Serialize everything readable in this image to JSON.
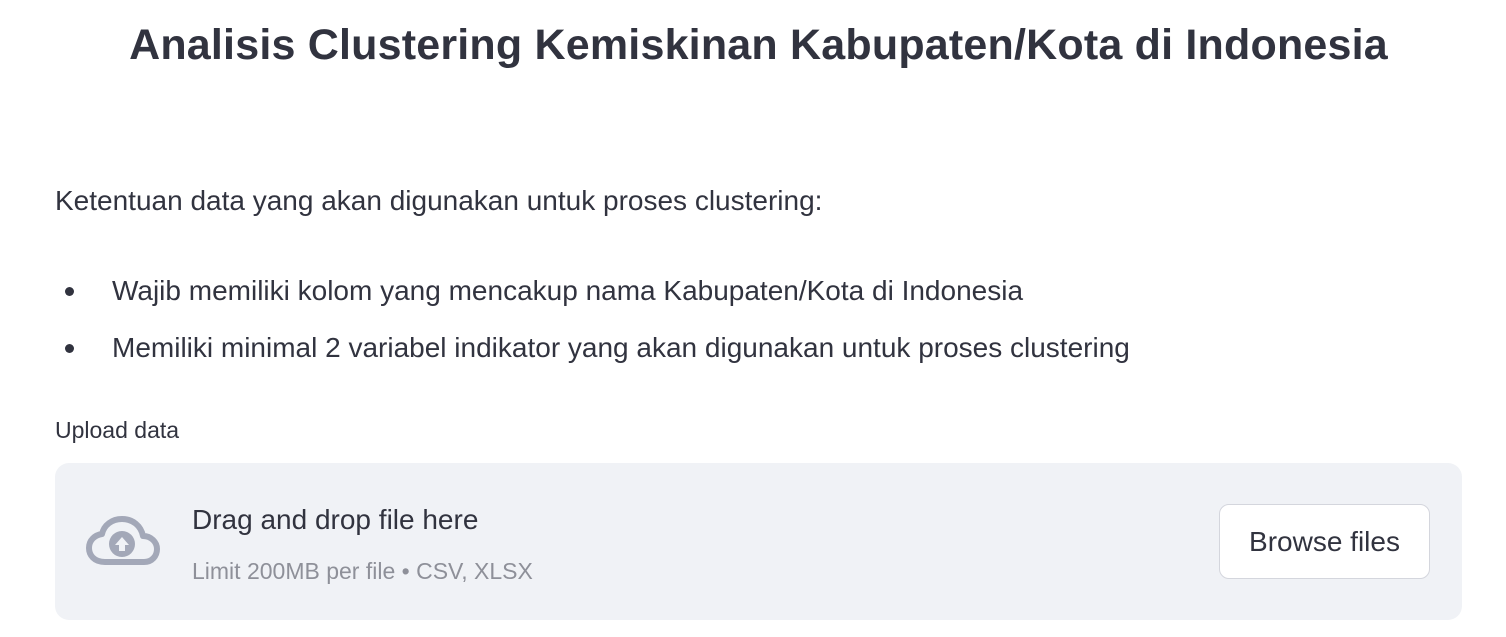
{
  "page": {
    "title": "Analisis Clustering Kemiskinan Kabupaten/Kota di Indonesia"
  },
  "requirements": {
    "intro": "Ketentuan data yang akan digunakan untuk proses clustering:",
    "items": [
      "Wajib memiliki kolom yang mencakup nama Kabupaten/Kota di Indonesia",
      "Memiliki minimal 2 variabel indikator yang akan digunakan untuk proses clustering"
    ]
  },
  "uploader": {
    "label": "Upload data",
    "drop_title": "Drag and drop file here",
    "drop_subtitle": "Limit 200MB per file • CSV, XLSX",
    "browse_label": "Browse files",
    "icon": "cloud-upload-icon"
  },
  "colors": {
    "text": "#31333f",
    "muted_text": "#8e9099",
    "dropzone_bg": "#f0f2f6",
    "icon": "#a3a8b8"
  }
}
